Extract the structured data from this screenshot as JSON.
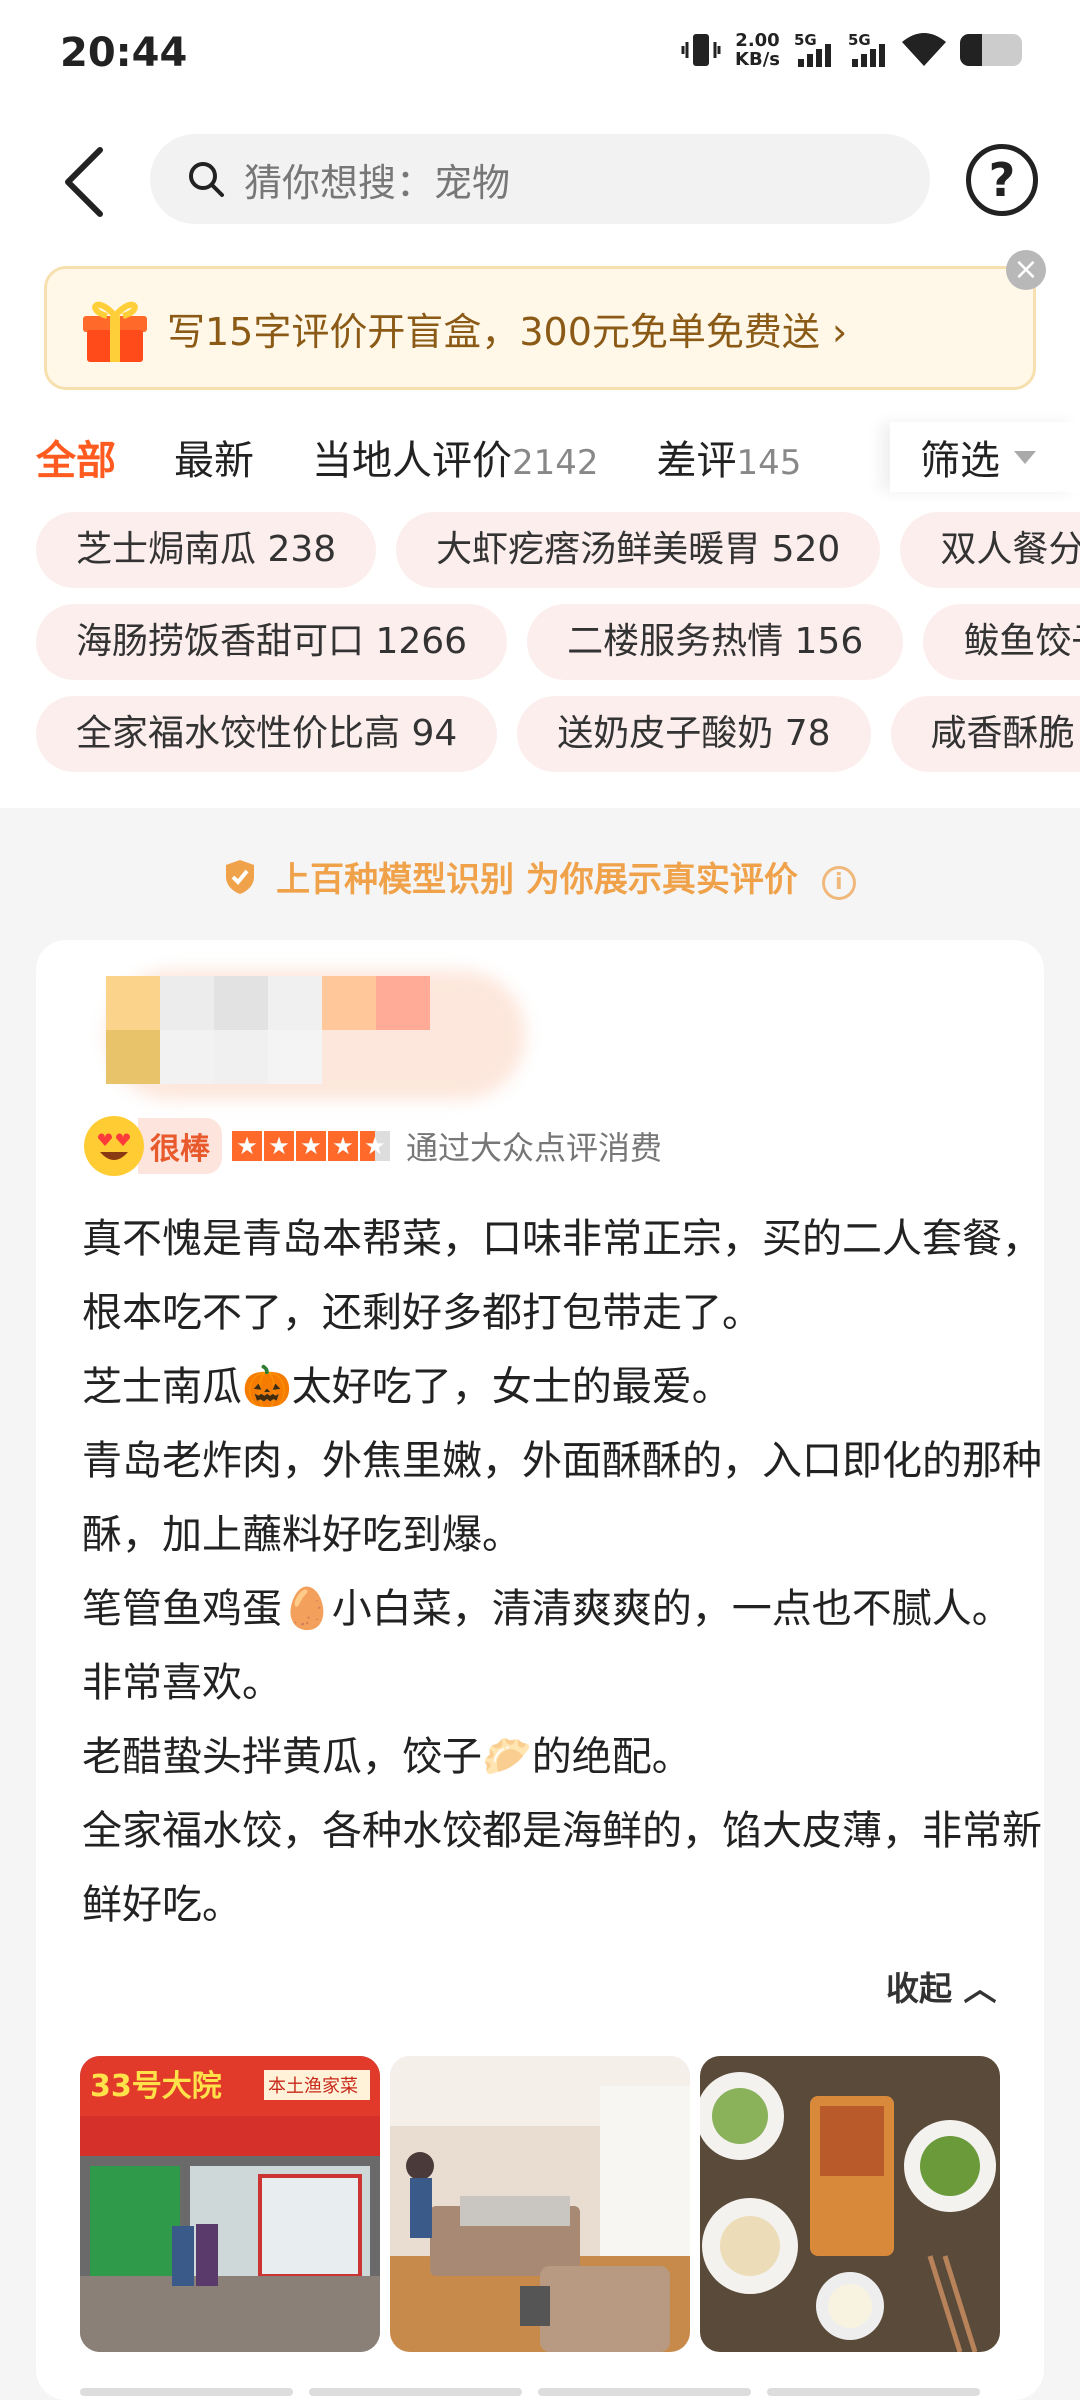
{
  "status_bar": {
    "time": "20:44",
    "net_speed_value": "2.00",
    "net_speed_unit": "KB/s",
    "sim1": "5G",
    "sim2": "5G",
    "battery_level": 0.35
  },
  "header": {
    "search_placeholder": "猜你想搜：宠物",
    "icons": [
      "back-arrow-icon",
      "search-icon",
      "help-icon"
    ]
  },
  "banner": {
    "text": "写15字评价开盲盒，300元免单免费送 ›",
    "close": "×"
  },
  "tabs": [
    {
      "label": "全部",
      "count": "",
      "active": true
    },
    {
      "label": "最新",
      "count": ""
    },
    {
      "label": "当地人评价",
      "count": "2142"
    },
    {
      "label": "差评",
      "count": "145"
    }
  ],
  "filter_label": "筛选",
  "tags": {
    "row1": [
      "芝士焗南瓜 238",
      "大虾疙瘩汤鲜美暖胃 520",
      "双人餐分"
    ],
    "row2": [
      "海肠捞饭香甜可口 1266",
      "二楼服务热情 156",
      "鲅鱼饺子"
    ],
    "row3": [
      "全家福水饺性价比高 94",
      "送奶皮子酸奶 78",
      "咸香酥脆"
    ]
  },
  "notice": {
    "text": "上百种模型识别 为你展示真实评价",
    "info": "i"
  },
  "review": {
    "badge": "很棒",
    "stars": 4.5,
    "via": "通过大众点评消费",
    "paragraphs": [
      "真不愧是青岛本帮菜，口味非常正宗，买的二人套餐，根本吃不了，还剩好多都打包带走了。",
      "芝士南瓜🎃太好吃了，女士的最爱。",
      "青岛老炸肉，外焦里嫩，外面酥酥的，入口即化的那种酥，加上蘸料好吃到爆。",
      "笔管鱼鸡蛋🥚小白菜，清清爽爽的，一点也不腻人。非常喜欢。",
      "老醋蛰头拌黄瓜，饺子🥟的绝配。",
      "全家福水饺，各种水饺都是海鲜的，馅大皮薄，非常新鲜好吃。"
    ],
    "collapse_label": "收起 ︿",
    "photo_sign_title": "33号大院",
    "photo_sign_sub": "本土渔家菜"
  },
  "colors": {
    "accent": "#ff5a1f",
    "tag_bg": "#fdeeee",
    "banner_bg": "#fff8e8",
    "notice": "#f0a24a"
  }
}
